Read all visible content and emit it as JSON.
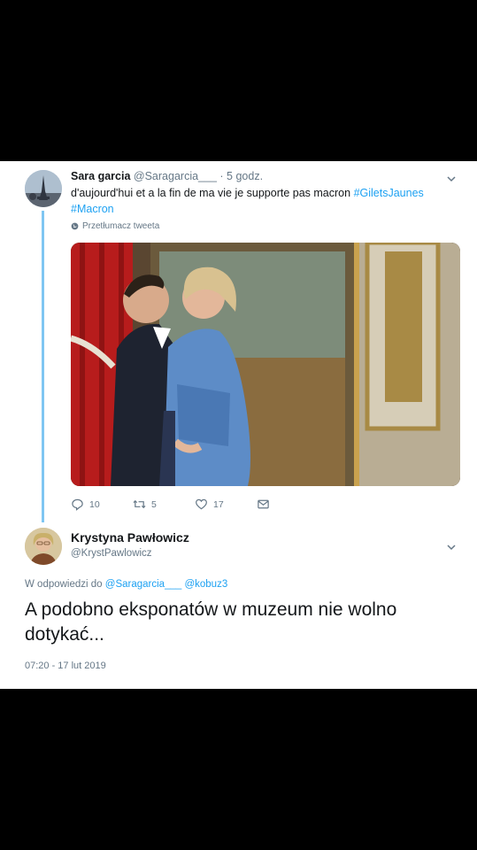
{
  "tweet1": {
    "name": "Sara garcia",
    "handle": "@Saragarcia___",
    "separator": "·",
    "time": "5 godz.",
    "text_before": "d'aujourd'hui et a la fin de ma vie je supporte pas macron",
    "hashtag1": "#GiletsJaunes",
    "hashtag2": "#Macron",
    "translate": "Przetłumacz tweeta",
    "replies": "10",
    "retweets": "5",
    "likes": "17",
    "avatar_icon": "eiffel-avatar",
    "menu_icon": "chevron-down-icon"
  },
  "tweet2": {
    "name": "Krystyna Pawłowicz",
    "handle": "@KrystPawlowicz",
    "reply_prefix": "W odpowiedzi do",
    "mention1": "@Saragarcia___",
    "mention2": "@kobuz3",
    "text": "A podobno eksponatów w muzeum nie wolno dotykać...",
    "timestamp": "07:20 - 17 lut 2019",
    "menu_icon": "chevron-down-icon"
  },
  "colors": {
    "link": "#1da1f2",
    "thread_line": "#7fc6f2",
    "secondary_text": "#657786",
    "background": "#000000"
  }
}
